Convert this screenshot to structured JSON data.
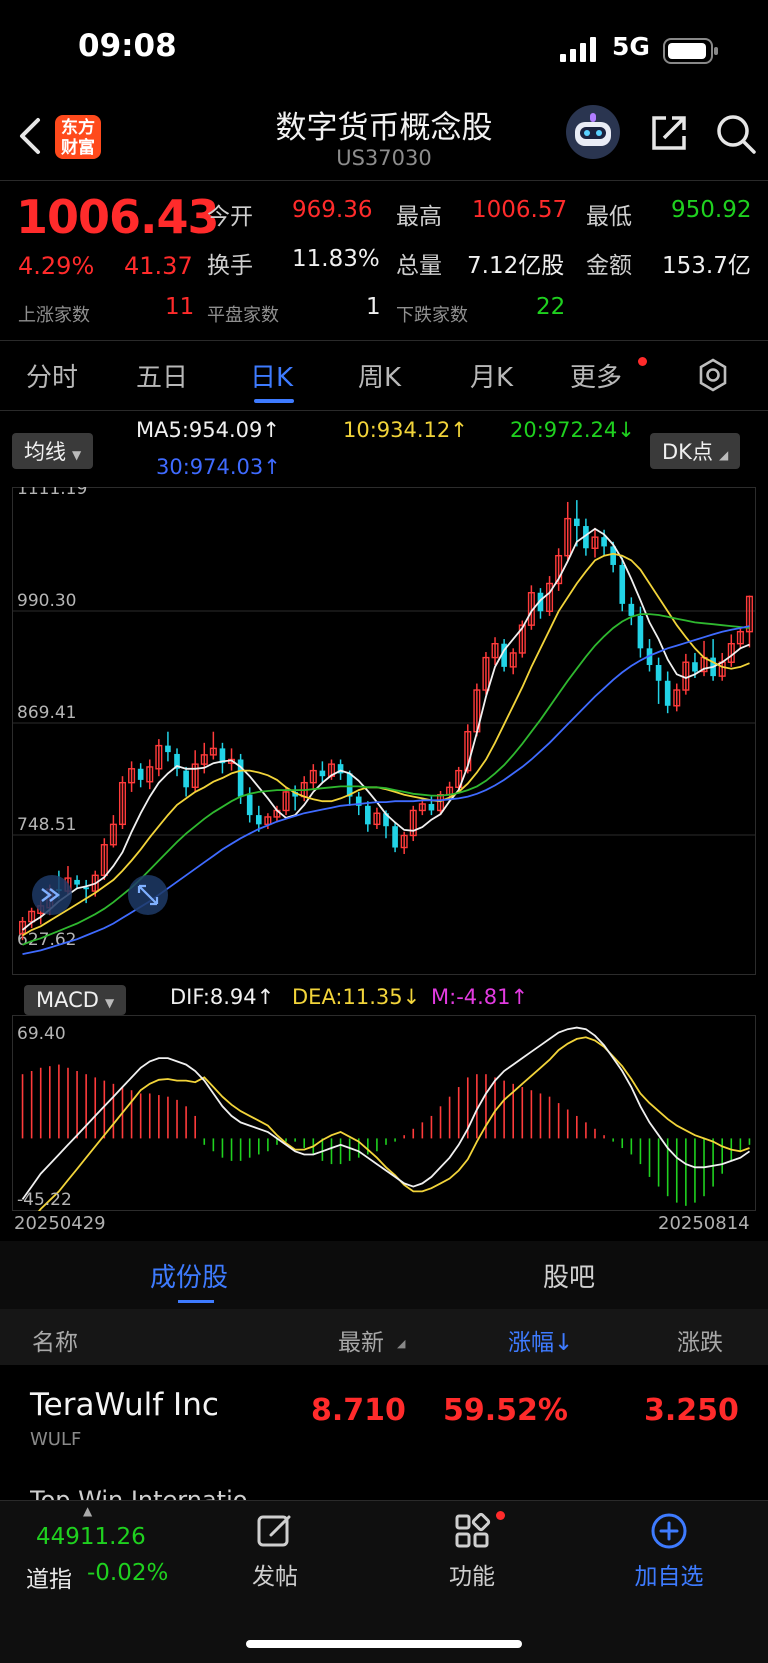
{
  "status_bar": {
    "time": "09:08",
    "network": "5G"
  },
  "header": {
    "logo_text": "东方财富",
    "title": "数字货币概念股",
    "code": "US37030"
  },
  "quote": {
    "price": "1006.43",
    "change_pct": "4.29%",
    "change": "41.37",
    "stats": [
      {
        "label": "今开",
        "value": "969.36",
        "color": "#ff2b2b"
      },
      {
        "label": "最高",
        "value": "1006.57",
        "color": "#ff2b2b"
      },
      {
        "label": "最低",
        "value": "950.92",
        "color": "#1fd11f"
      },
      {
        "label": "换手",
        "value": "11.83%",
        "color": "#f0f0f0"
      },
      {
        "label": "总量",
        "value": "7.12亿股",
        "color": "#f0f0f0"
      },
      {
        "label": "金额",
        "value": "153.7亿",
        "color": "#f0f0f0"
      }
    ],
    "breadth": [
      {
        "label": "上涨家数",
        "value": "11",
        "color": "#ff2b2b"
      },
      {
        "label": "平盘家数",
        "value": "1",
        "color": "#f0f0f0"
      },
      {
        "label": "下跌家数",
        "value": "22",
        "color": "#1fd11f"
      }
    ]
  },
  "period_tabs": [
    "分时",
    "五日",
    "日K",
    "周K",
    "月K",
    "更多"
  ],
  "active_period": "日K",
  "indicators": {
    "ma_dropdown": "均线",
    "ma5": "MA5:954.09↑",
    "ma10": "10:934.12↑",
    "ma20": "20:972.24↓",
    "ma30": "30:974.03↑",
    "dk_button": "DK点",
    "macd_dropdown": "MACD",
    "dif": "DIF:8.94↑",
    "dea": "DEA:11.35↓",
    "m": "M:-4.81↑"
  },
  "chart_data": {
    "type": "candlestick",
    "y_labels": [
      "1111.19",
      "990.30",
      "869.41",
      "748.51",
      "627.62"
    ],
    "ylim": [
      627.62,
      1111.19
    ],
    "macd_y_labels": [
      "69.40",
      "-45.22"
    ],
    "macd_ylim": [
      -45.22,
      69.4
    ],
    "x_start": "20250429",
    "x_end": "20250814",
    "candles": [
      [
        642,
        655,
        635,
        660
      ],
      [
        655,
        666,
        648,
        670
      ],
      [
        664,
        672,
        652,
        678
      ],
      [
        670,
        690,
        662,
        695
      ],
      [
        690,
        688,
        680,
        710
      ],
      [
        688,
        702,
        684,
        715
      ],
      [
        700,
        695,
        690,
        705
      ],
      [
        692,
        690,
        675,
        700
      ],
      [
        688,
        705,
        682,
        710
      ],
      [
        705,
        738,
        700,
        745
      ],
      [
        738,
        760,
        735,
        770
      ],
      [
        760,
        805,
        755,
        812
      ],
      [
        805,
        820,
        795,
        828
      ],
      [
        820,
        808,
        800,
        826
      ],
      [
        806,
        822,
        798,
        830
      ],
      [
        820,
        845,
        812,
        852
      ],
      [
        845,
        838,
        828,
        860
      ],
      [
        836,
        820,
        812,
        842
      ],
      [
        818,
        800,
        790,
        822
      ],
      [
        800,
        825,
        795,
        840
      ],
      [
        825,
        835,
        815,
        848
      ],
      [
        835,
        842,
        830,
        860
      ],
      [
        842,
        826,
        815,
        848
      ],
      [
        826,
        830,
        818,
        842
      ],
      [
        830,
        790,
        782,
        836
      ],
      [
        792,
        770,
        762,
        800
      ],
      [
        770,
        760,
        752,
        780
      ],
      [
        760,
        768,
        755,
        772
      ],
      [
        768,
        775,
        762,
        780
      ],
      [
        775,
        795,
        770,
        800
      ],
      [
        795,
        790,
        775,
        802
      ],
      [
        790,
        805,
        785,
        812
      ],
      [
        805,
        818,
        798,
        825
      ],
      [
        818,
        812,
        805,
        828
      ],
      [
        812,
        825,
        808,
        830
      ],
      [
        825,
        815,
        808,
        830
      ],
      [
        815,
        790,
        780,
        818
      ],
      [
        790,
        780,
        770,
        795
      ],
      [
        780,
        760,
        752,
        785
      ],
      [
        760,
        772,
        755,
        778
      ],
      [
        772,
        758,
        745,
        775
      ],
      [
        758,
        735,
        730,
        762
      ],
      [
        735,
        748,
        728,
        752
      ],
      [
        748,
        775,
        742,
        780
      ],
      [
        775,
        782,
        770,
        788
      ],
      [
        782,
        775,
        770,
        790
      ],
      [
        775,
        792,
        770,
        796
      ],
      [
        792,
        800,
        788,
        806
      ],
      [
        800,
        818,
        795,
        822
      ],
      [
        818,
        860,
        815,
        868
      ],
      [
        860,
        905,
        855,
        912
      ],
      [
        905,
        940,
        900,
        946
      ],
      [
        940,
        955,
        932,
        962
      ],
      [
        955,
        930,
        925,
        960
      ],
      [
        930,
        945,
        922,
        950
      ],
      [
        945,
        975,
        940,
        980
      ],
      [
        975,
        1010,
        970,
        1018
      ],
      [
        1010,
        990,
        982,
        1015
      ],
      [
        990,
        1020,
        985,
        1028
      ],
      [
        1020,
        1050,
        1012,
        1058
      ],
      [
        1050,
        1090,
        1045,
        1108
      ],
      [
        1090,
        1082,
        1060,
        1110
      ],
      [
        1082,
        1058,
        1050,
        1090
      ],
      [
        1058,
        1070,
        1048,
        1080
      ],
      [
        1070,
        1060,
        1050,
        1078
      ],
      [
        1060,
        1040,
        1032,
        1065
      ],
      [
        1040,
        998,
        990,
        1048
      ],
      [
        998,
        985,
        975,
        1005
      ],
      [
        985,
        950,
        940,
        995
      ],
      [
        950,
        932,
        925,
        960
      ],
      [
        932,
        915,
        890,
        940
      ],
      [
        915,
        888,
        880,
        925
      ],
      [
        888,
        905,
        882,
        912
      ],
      [
        905,
        935,
        900,
        944
      ],
      [
        935,
        925,
        918,
        945
      ],
      [
        925,
        940,
        920,
        958
      ],
      [
        940,
        920,
        915,
        960
      ],
      [
        920,
        935,
        915,
        945
      ],
      [
        935,
        955,
        930,
        965
      ],
      [
        955,
        968,
        950,
        972
      ],
      [
        968,
        1006,
        951,
        1007
      ]
    ],
    "series": [
      {
        "name": "MA5",
        "color": "#f0f0f0",
        "values": [
          646,
          654,
          660,
          668,
          677,
          684,
          691,
          693,
          696,
          703,
          715,
          730,
          752,
          772,
          790,
          805,
          815,
          823,
          820,
          820,
          821,
          826,
          828,
          829,
          822,
          812,
          800,
          788,
          775,
          767,
          770,
          781,
          795,
          805,
          813,
          818,
          815,
          807,
          796,
          784,
          771,
          762,
          754,
          753,
          757,
          765,
          771,
          785,
          797,
          823,
          859,
          898,
          930,
          948,
          960,
          972,
          990,
          1002,
          1010,
          1025,
          1044,
          1065,
          1072,
          1079,
          1073,
          1062,
          1046,
          1025,
          1002,
          978,
          960,
          938,
          922,
          918,
          922,
          928,
          930,
          935,
          942,
          950,
          954
        ]
      },
      {
        "name": "10",
        "color": "#f2d43a",
        "values": [
          640,
          646,
          650,
          656,
          662,
          668,
          674,
          680,
          686,
          693,
          700,
          710,
          721,
          733,
          746,
          758,
          770,
          781,
          788,
          795,
          800,
          806,
          810,
          815,
          818,
          818,
          816,
          813,
          808,
          800,
          794,
          790,
          787,
          785,
          785,
          788,
          792,
          797,
          800,
          800,
          798,
          795,
          792,
          790,
          788,
          786,
          785,
          789,
          795,
          804,
          816,
          830,
          848,
          868,
          888,
          908,
          930,
          950,
          970,
          990,
          1005,
          1020,
          1033,
          1045,
          1050,
          1052,
          1050,
          1045,
          1035,
          1020,
          1005,
          990,
          975,
          962,
          950,
          940,
          935,
          930,
          928,
          930,
          934
        ]
      },
      {
        "name": "20",
        "color": "#2fb82f",
        "values": [
          630,
          634,
          637,
          641,
          645,
          649,
          653,
          658,
          663,
          669,
          676,
          684,
          692,
          701,
          711,
          721,
          731,
          741,
          750,
          758,
          766,
          773,
          779,
          785,
          790,
          793,
          795,
          796,
          797,
          797,
          797,
          797,
          798,
          799,
          800,
          801,
          801,
          801,
          800,
          800,
          799,
          797,
          795,
          793,
          792,
          791,
          791,
          792,
          794,
          797,
          801,
          807,
          815,
          824,
          835,
          847,
          860,
          873,
          887,
          901,
          915,
          928,
          941,
          953,
          963,
          972,
          979,
          984,
          987,
          987,
          986,
          984,
          982,
          980,
          978,
          977,
          976,
          975,
          974,
          973,
          972
        ]
      },
      {
        "name": "30",
        "color": "#3f6bff",
        "values": [
          620,
          622,
          624,
          627,
          630,
          633,
          636,
          640,
          644,
          648,
          653,
          659,
          665,
          671,
          677,
          684,
          691,
          698,
          705,
          712,
          719,
          726,
          733,
          739,
          745,
          750,
          755,
          759,
          763,
          766,
          769,
          772,
          774,
          776,
          778,
          780,
          781,
          782,
          783,
          784,
          784,
          785,
          785,
          785,
          786,
          786,
          786,
          787,
          788,
          790,
          793,
          797,
          802,
          808,
          815,
          822,
          830,
          839,
          848,
          858,
          868,
          878,
          888,
          898,
          907,
          916,
          924,
          931,
          937,
          942,
          946,
          950,
          953,
          956,
          959,
          962,
          965,
          968,
          970,
          972,
          974
        ]
      }
    ],
    "macd_bars": [
      40,
      42,
      44,
      45,
      46,
      44,
      42,
      40,
      38,
      36,
      34,
      32,
      30,
      28,
      28,
      27,
      26,
      24,
      20,
      14,
      -4,
      -8,
      -12,
      -14,
      -14,
      -12,
      -10,
      -8,
      -4,
      -2,
      -2,
      -6,
      -10,
      -14,
      -16,
      -16,
      -14,
      -12,
      -10,
      -8,
      -4,
      -2,
      2,
      6,
      10,
      14,
      20,
      26,
      32,
      38,
      40,
      40,
      38,
      36,
      34,
      32,
      30,
      28,
      26,
      22,
      18,
      14,
      10,
      6,
      2,
      -2,
      -6,
      -10,
      -16,
      -24,
      -30,
      -36,
      -40,
      -42,
      -40,
      -36,
      -30,
      -22,
      -14,
      -8,
      -4
    ],
    "macd_dif": [
      -38,
      -30,
      -22,
      -16,
      -10,
      -4,
      2,
      8,
      14,
      20,
      26,
      32,
      38,
      44,
      48,
      50,
      50,
      48,
      46,
      42,
      36,
      28,
      20,
      14,
      10,
      8,
      6,
      4,
      0,
      -4,
      -8,
      -10,
      -10,
      -8,
      -6,
      -4,
      -6,
      -8,
      -12,
      -16,
      -20,
      -24,
      -28,
      -30,
      -28,
      -24,
      -18,
      -12,
      -4,
      6,
      18,
      28,
      36,
      42,
      46,
      50,
      54,
      58,
      62,
      66,
      68,
      69,
      68,
      64,
      58,
      50,
      42,
      32,
      20,
      10,
      2,
      -6,
      -12,
      -16,
      -18,
      -18,
      -17,
      -16,
      -14,
      -12,
      -8
    ]
  },
  "list": {
    "tabs": [
      "成份股",
      "股吧"
    ],
    "active_tab": "成份股",
    "columns": [
      "名称",
      "最新",
      "涨幅↓",
      "涨跌"
    ],
    "rows": [
      {
        "name": "TeraWulf Inc",
        "code": "WULF",
        "latest": "8.710",
        "pct": "59.52%",
        "change": "3.250"
      }
    ],
    "next_row_peek": "Top Win Internatio"
  },
  "bottom_nav": {
    "index_value": "44911.26",
    "index_name": "道指",
    "index_pct": "-0.02%",
    "post": "发帖",
    "func": "功能",
    "add": "加自选"
  }
}
